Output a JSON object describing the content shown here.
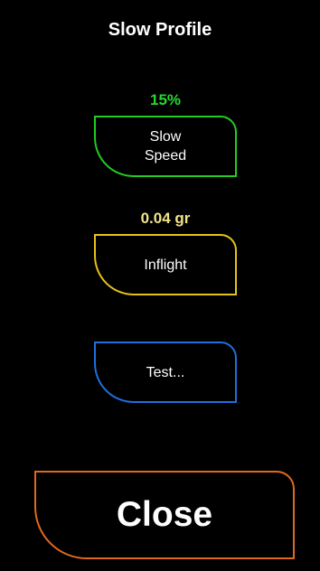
{
  "header": {
    "title": "Slow Profile"
  },
  "slow_speed": {
    "value": "15%",
    "label": "Slow\nSpeed",
    "value_color": "#27d82b",
    "border_color": "#22cc22"
  },
  "inflight": {
    "value": "0.04 gr",
    "label": "Inflight",
    "value_color": "#f2e38a",
    "border_color": "#e6c21a"
  },
  "test": {
    "label": "Test...",
    "border_color": "#1f6fe0"
  },
  "footer": {
    "close_label": "Close",
    "border_color": "#e0691f"
  }
}
